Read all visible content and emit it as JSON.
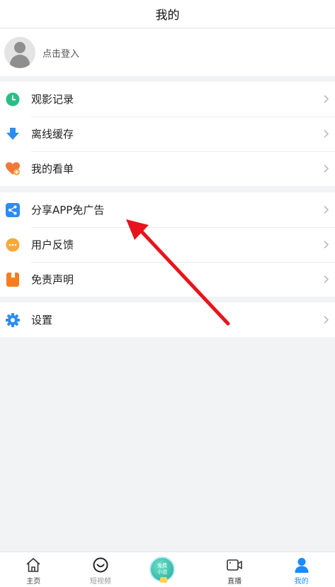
{
  "header": {
    "title": "我的"
  },
  "login": {
    "prompt": "点击登入"
  },
  "menu": {
    "group1": [
      {
        "label": "观影记录",
        "icon": "clock-icon",
        "color": "#2bbd84"
      },
      {
        "label": "离线缓存",
        "icon": "download-icon",
        "color": "#2d8cf0"
      },
      {
        "label": "我的看单",
        "icon": "heart-plus-icon",
        "color": "#f0793a"
      }
    ],
    "group2": [
      {
        "label": "分享APP免广告",
        "icon": "share-icon",
        "color": "#2d8cf0"
      },
      {
        "label": "用户反馈",
        "icon": "chat-bubble-icon",
        "color": "#f8a93a"
      },
      {
        "label": "免责声明",
        "icon": "bookmark-icon",
        "color": "#f57d1f"
      }
    ],
    "group3": [
      {
        "label": "设置",
        "icon": "gear-icon",
        "color": "#2d8cf0"
      }
    ]
  },
  "tabs": [
    {
      "label": "主页",
      "icon": "home-icon"
    },
    {
      "label": "短视频",
      "icon": "smile-icon"
    },
    {
      "label": "",
      "icon": "free-novel-badge",
      "badge_text": [
        "免费",
        "小说"
      ]
    },
    {
      "label": "直播",
      "icon": "video-camera-icon"
    },
    {
      "label": "我的",
      "icon": "person-icon",
      "active": true
    }
  ],
  "accent_color": "#1a8cff",
  "annotation": {
    "type": "arrow",
    "color": "#e8141b"
  }
}
